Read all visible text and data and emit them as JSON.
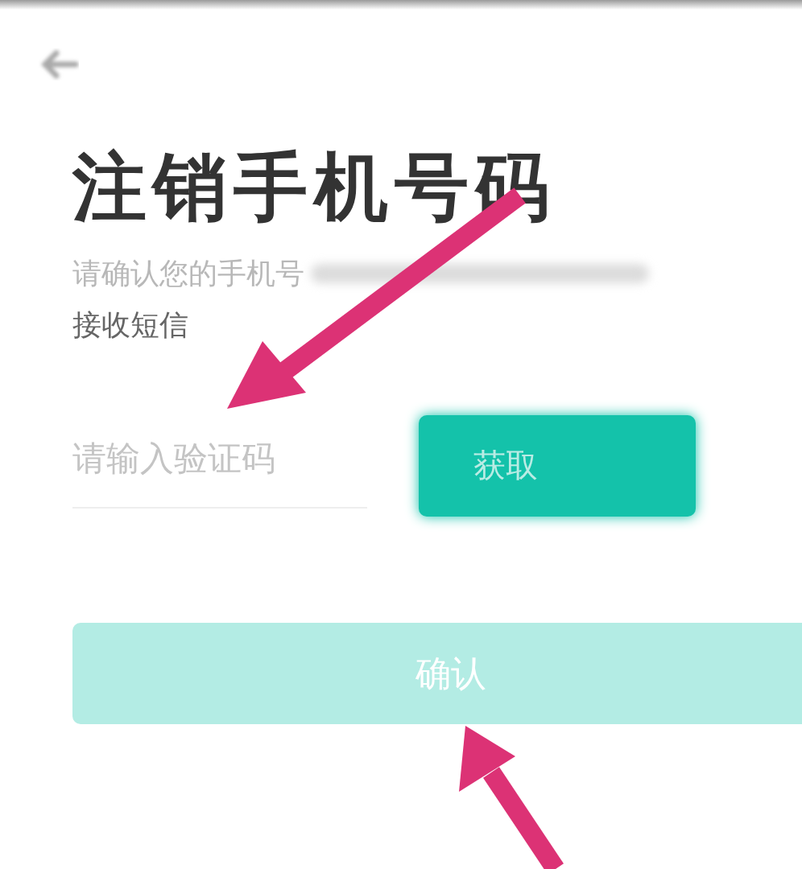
{
  "title": "注销手机号码",
  "prompt": {
    "line_1": "请确认您的手机号",
    "line_2": "接收短信"
  },
  "code_field": {
    "placeholder": "请输入验证码"
  },
  "get_code_button": {
    "label": "获取"
  },
  "confirm_button": {
    "label": "确认",
    "disabled": true
  }
}
